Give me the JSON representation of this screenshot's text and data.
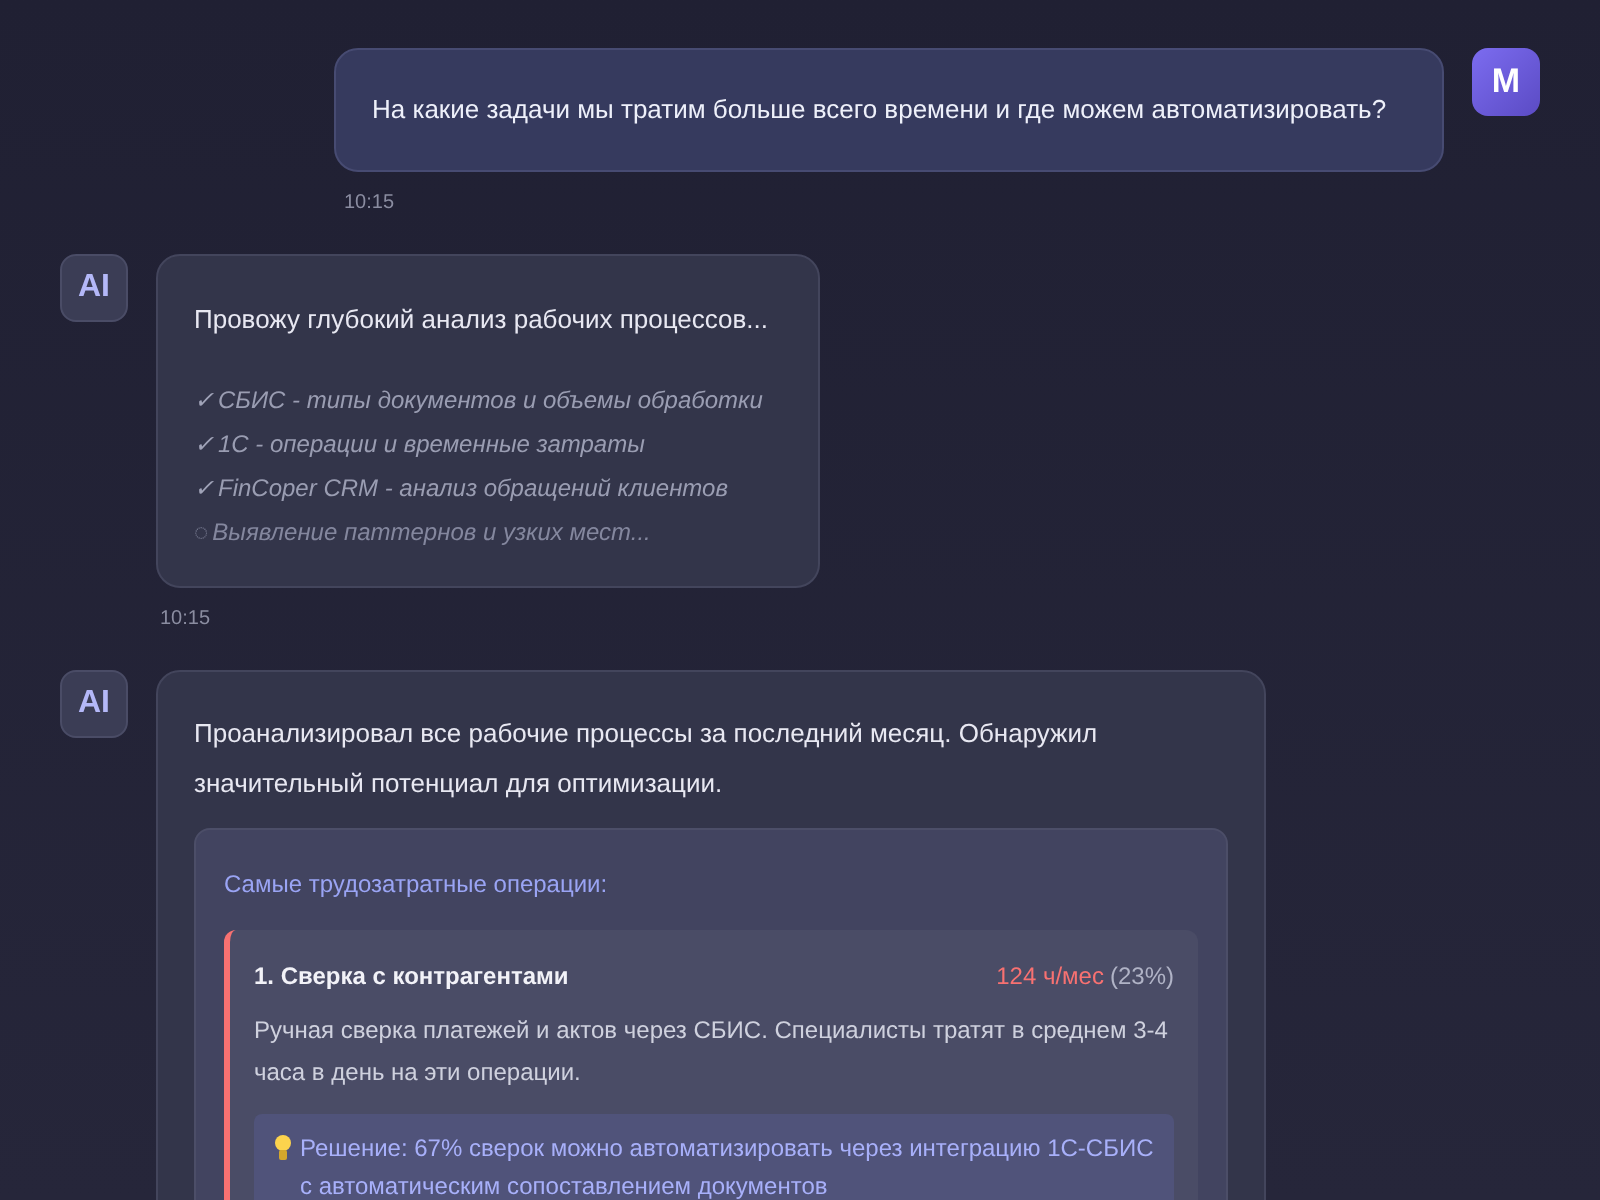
{
  "messages": [
    {
      "kind": "user",
      "avatar": "M",
      "text": "На какие задачи мы тратим больше всего времени и где можем автоматизировать?",
      "time": "10:15"
    },
    {
      "kind": "progress",
      "avatar": "AI",
      "text": "Провожу глубокий анализ рабочих процессов...",
      "steps": [
        {
          "mark": "✓",
          "text": "СБИС - типы документов и объемы обработки",
          "done": true
        },
        {
          "mark": "✓",
          "text": "1С - операции и временные затраты",
          "done": true
        },
        {
          "mark": "✓",
          "text": "FinCoper CRM - анализ обращений клиентов",
          "done": true
        },
        {
          "mark": "◌",
          "text": "Выявление паттернов и узких мест...",
          "done": false
        }
      ],
      "time": "10:15"
    },
    {
      "kind": "report",
      "avatar": "AI",
      "text": "Проанализировал все рабочие процессы за последний месяц. Обнаружил значительный потенциал для оптимизации.",
      "card": {
        "heading": "Самые трудозатратные операции:",
        "items": [
          {
            "title": "1. Сверка с контрагентами",
            "hours": "124 ч/мес",
            "share": "(23%)",
            "color": "#f87171",
            "description": "Ручная сверка платежей и актов через СБИС. Специалисты тратят в среднем 3-4 часа в день на эти операции.",
            "solution": "Решение: 67% сверок можно автоматизировать через интеграцию 1С-СБИС с автоматическим сопоставлением документов"
          }
        ]
      }
    }
  ]
}
